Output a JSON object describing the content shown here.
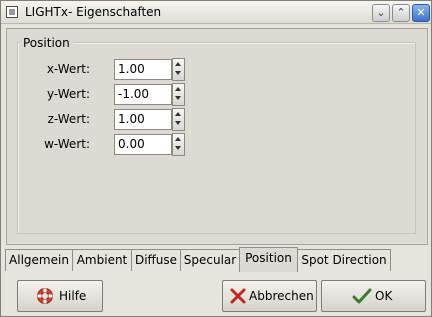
{
  "window": {
    "title": "LIGHTx- Eigenschaften"
  },
  "titlebar_buttons": {
    "minimize": "⌄",
    "maximize": "⌃",
    "close": "✕"
  },
  "position_frame": {
    "title": "Position",
    "fields": [
      {
        "label": "x-Wert:",
        "value": "1.00"
      },
      {
        "label": "y-Wert:",
        "value": "-1.00"
      },
      {
        "label": "z-Wert:",
        "value": "1.00"
      },
      {
        "label": "w-Wert:",
        "value": "0.00"
      }
    ]
  },
  "tabs": [
    {
      "label": "Allgemein"
    },
    {
      "label": "Ambient"
    },
    {
      "label": "Diffuse"
    },
    {
      "label": "Specular"
    },
    {
      "label": "Position"
    },
    {
      "label": "Spot Direction"
    }
  ],
  "active_tab": "Position",
  "buttons": {
    "help": "Hilfe",
    "cancel": "Abbrechen",
    "ok": "OK"
  },
  "icons": {
    "help": "lifebuoy-icon",
    "cancel": "cross-icon",
    "ok": "checkmark-icon"
  },
  "colors": {
    "window_bg": "#e6e4dc",
    "close_button": "#3d73c9"
  }
}
